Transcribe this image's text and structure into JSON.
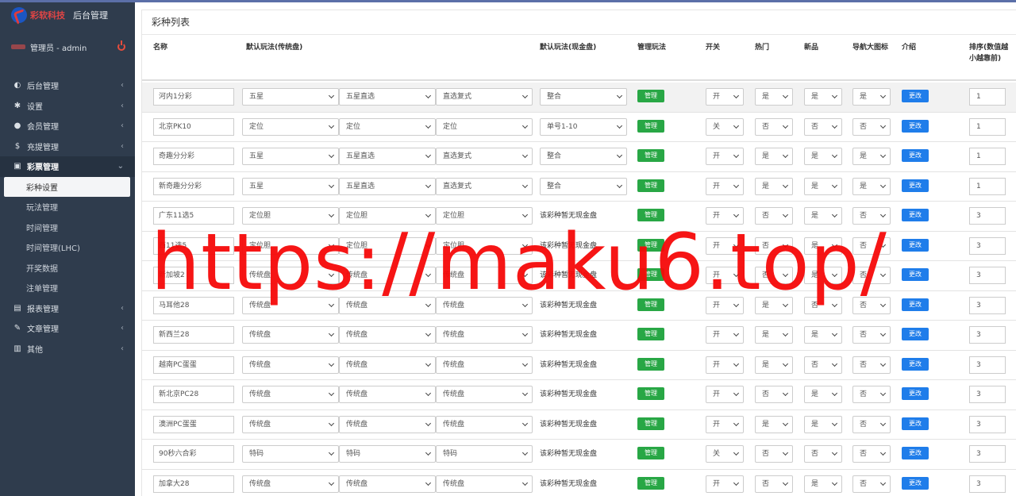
{
  "brand": {
    "name": "彩软科技",
    "subtitle": "后台管理"
  },
  "user": {
    "label": "管理员 - admin"
  },
  "menu": [
    {
      "label": "后台管理",
      "icon": "dashboard-icon",
      "glyph": "◐",
      "type": "parent"
    },
    {
      "label": "设置",
      "icon": "gear-icon",
      "glyph": "✱",
      "type": "parent"
    },
    {
      "label": "会员管理",
      "icon": "user-icon",
      "glyph": "●",
      "type": "parent"
    },
    {
      "label": "充提管理",
      "icon": "dollar-icon",
      "glyph": "$",
      "type": "parent"
    },
    {
      "label": "彩票管理",
      "icon": "cc-icon",
      "glyph": "▣",
      "type": "active-parent"
    },
    {
      "label": "彩种设置",
      "type": "sub-active"
    },
    {
      "label": "玩法管理",
      "type": "sub"
    },
    {
      "label": "时间管理",
      "type": "sub"
    },
    {
      "label": "时间管理(LHC)",
      "type": "sub"
    },
    {
      "label": "开奖数据",
      "type": "sub"
    },
    {
      "label": "注单管理",
      "type": "sub"
    },
    {
      "label": "报表管理",
      "icon": "file-icon",
      "glyph": "▤",
      "type": "parent"
    },
    {
      "label": "文章管理",
      "icon": "edit-icon",
      "glyph": "✎",
      "type": "parent"
    },
    {
      "label": "其他",
      "icon": "trash-icon",
      "glyph": "▥",
      "type": "parent"
    }
  ],
  "panel": {
    "title": "彩种列表"
  },
  "columns": {
    "name": "名称",
    "trad": "默认玩法(传统盘)",
    "cash": "默认玩法(现金盘)",
    "manage": "管理玩法",
    "switch": "开关",
    "hot": "热门",
    "new": "新品",
    "navicon": "导航大图标",
    "intro": "介绍",
    "sort": "排序(数值越小越靠前)"
  },
  "buttons": {
    "manage": "管理",
    "edit": "更改"
  },
  "no_cash_text": "该彩种暂无现金盘",
  "rows": [
    {
      "name": "河内1分彩",
      "t1": "五星",
      "t2": "五星直选",
      "t3": "直选复式",
      "cash": "整合",
      "sw": "开",
      "hot": "是",
      "new": "是",
      "nav": "是",
      "sort": "1"
    },
    {
      "name": "北京PK10",
      "t1": "定位",
      "t2": "定位",
      "t3": "定位",
      "cash": "单号1-10",
      "sw": "关",
      "hot": "否",
      "new": "否",
      "nav": "否",
      "sort": "1"
    },
    {
      "name": "奇趣分分彩",
      "t1": "五星",
      "t2": "五星直选",
      "t3": "直选复式",
      "cash": "整合",
      "sw": "开",
      "hot": "是",
      "new": "是",
      "nav": "是",
      "sort": "1"
    },
    {
      "name": "新奇趣分分彩",
      "t1": "五星",
      "t2": "五星直选",
      "t3": "直选复式",
      "cash": "整合",
      "sw": "开",
      "hot": "是",
      "new": "是",
      "nav": "是",
      "sort": "1"
    },
    {
      "name": "广东11选5",
      "t1": "定位胆",
      "t2": "定位胆",
      "t3": "定位胆",
      "cash": "",
      "sw": "开",
      "hot": "否",
      "new": "是",
      "nav": "否",
      "sort": "3"
    },
    {
      "name": "西11选5",
      "t1": "定位胆",
      "t2": "定位胆",
      "t3": "定位胆",
      "cash": "",
      "sw": "开",
      "hot": "否",
      "new": "是",
      "nav": "否",
      "sort": "3"
    },
    {
      "name": "新加坡2",
      "t1": "传统盘",
      "t2": "传统盘",
      "t3": "传统盘",
      "cash": "",
      "sw": "开",
      "hot": "否",
      "new": "是",
      "nav": "否",
      "sort": "3"
    },
    {
      "name": "马耳他28",
      "t1": "传统盘",
      "t2": "传统盘",
      "t3": "传统盘",
      "cash": "",
      "sw": "开",
      "hot": "是",
      "new": "否",
      "nav": "否",
      "sort": "3"
    },
    {
      "name": "新西兰28",
      "t1": "传统盘",
      "t2": "传统盘",
      "t3": "传统盘",
      "cash": "",
      "sw": "开",
      "hot": "是",
      "new": "是",
      "nav": "否",
      "sort": "3"
    },
    {
      "name": "越南PC蛋蛋",
      "t1": "传统盘",
      "t2": "传统盘",
      "t3": "传统盘",
      "cash": "",
      "sw": "开",
      "hot": "是",
      "new": "否",
      "nav": "否",
      "sort": "3"
    },
    {
      "name": "新北京PC28",
      "t1": "传统盘",
      "t2": "传统盘",
      "t3": "传统盘",
      "cash": "",
      "sw": "开",
      "hot": "否",
      "new": "是",
      "nav": "否",
      "sort": "3"
    },
    {
      "name": "澳洲PC蛋蛋",
      "t1": "传统盘",
      "t2": "传统盘",
      "t3": "传统盘",
      "cash": "",
      "sw": "开",
      "hot": "是",
      "new": "是",
      "nav": "否",
      "sort": "3"
    },
    {
      "name": "90秒六合彩",
      "t1": "特码",
      "t2": "特码",
      "t3": "特码",
      "cash": "",
      "sw": "关",
      "hot": "否",
      "new": "否",
      "nav": "否",
      "sort": "3"
    },
    {
      "name": "加拿大28",
      "t1": "传统盘",
      "t2": "传统盘",
      "t3": "传统盘",
      "cash": "",
      "sw": "开",
      "hot": "否",
      "new": "是",
      "nav": "否",
      "sort": "3"
    }
  ],
  "watermark": "https://maku6.top/",
  "colors": {
    "sidebar": "#2f3c4d",
    "manage_button": "#28a745",
    "edit_button": "#1f7dea",
    "watermark": "#f50808"
  }
}
